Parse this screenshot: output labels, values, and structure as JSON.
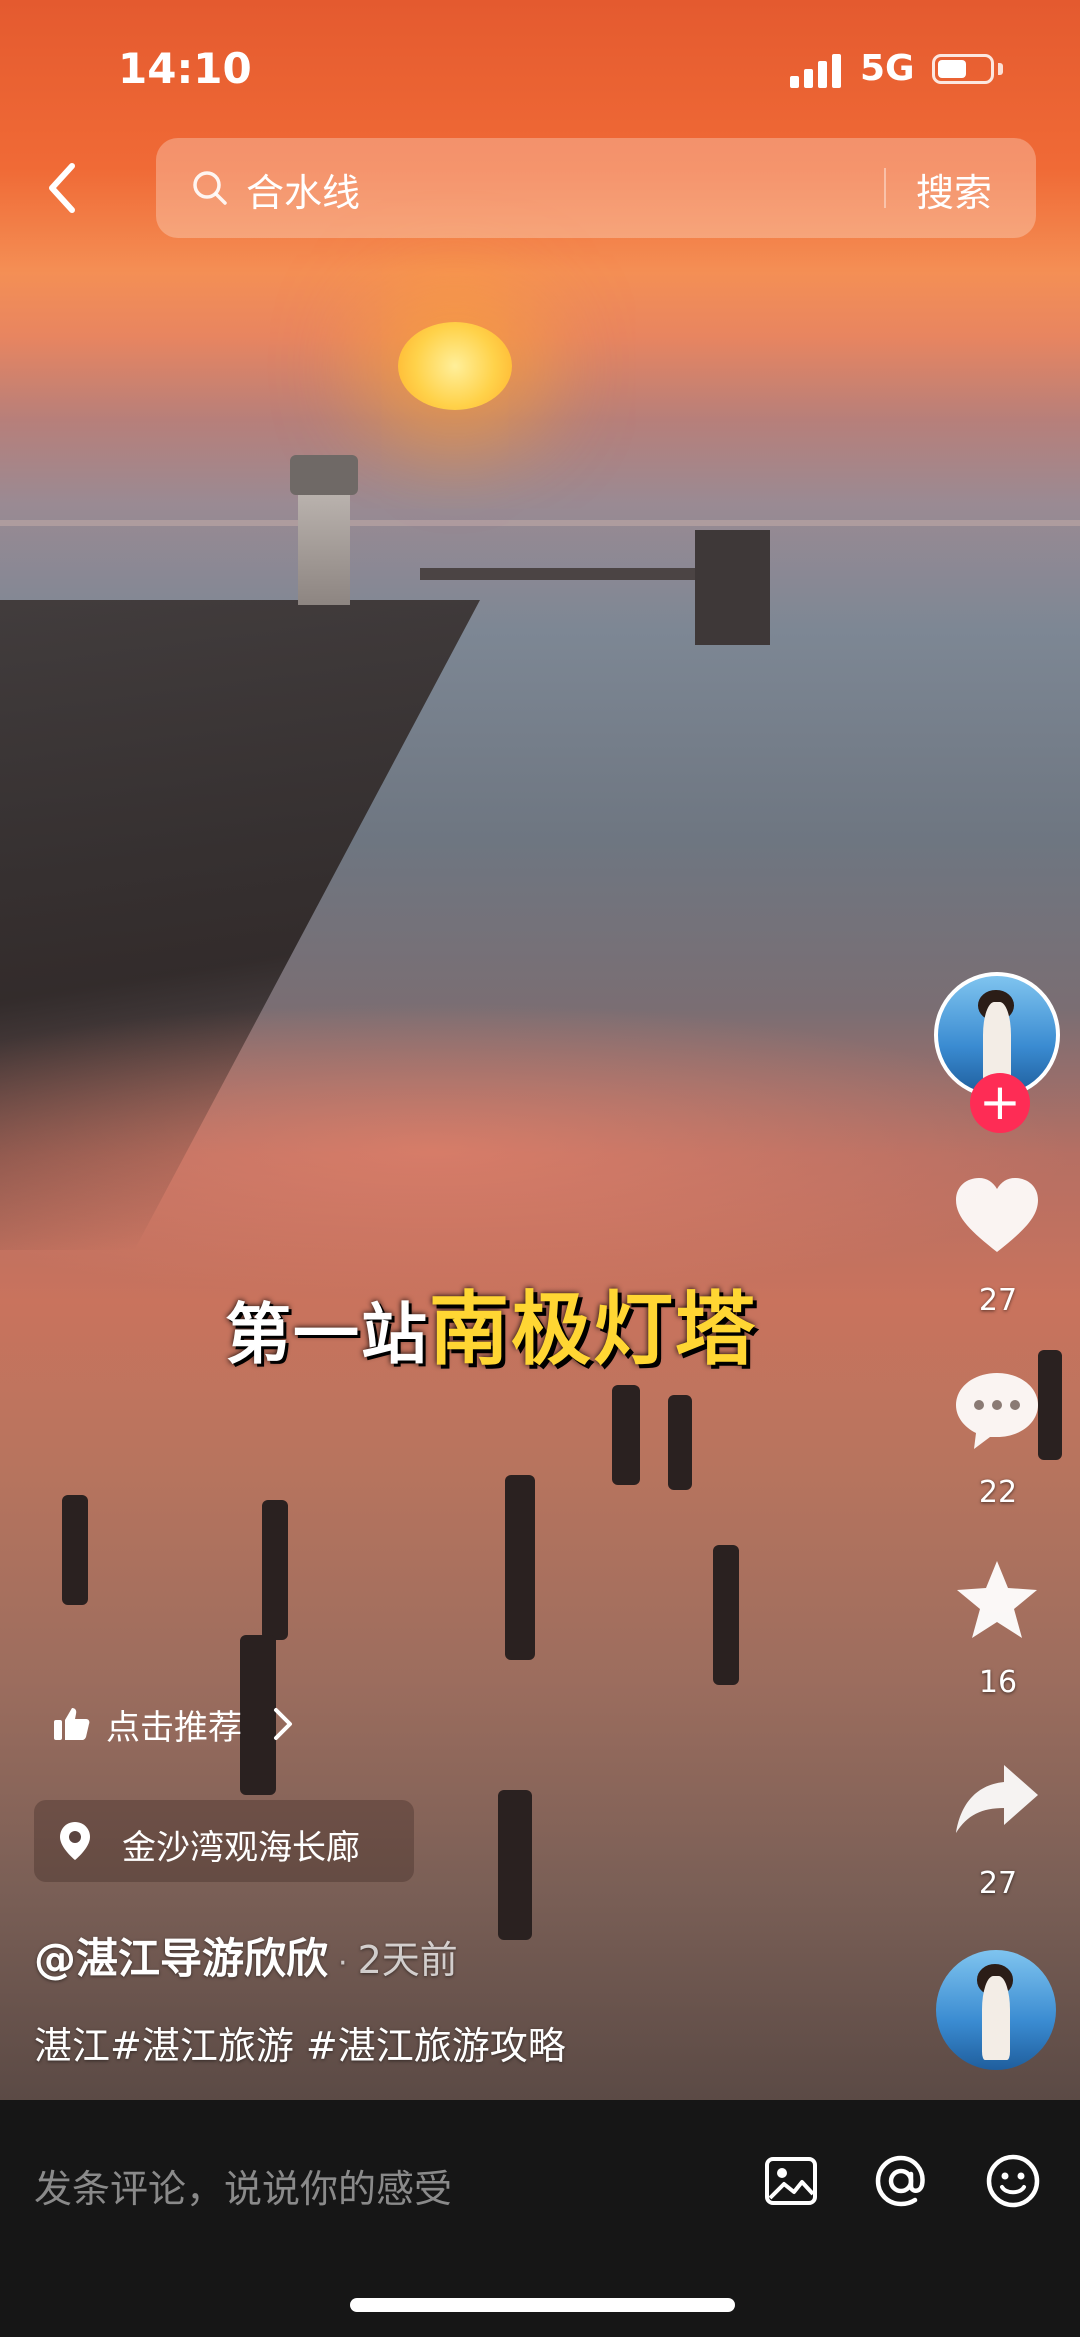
{
  "status_bar": {
    "time": "14:10",
    "network": "5G",
    "battery_level": 0.55
  },
  "search": {
    "query": "合水线",
    "button_label": "搜索"
  },
  "video": {
    "caption_white": "第一站",
    "caption_yellow": "南极灯塔"
  },
  "actions": {
    "likes": "27",
    "comments": "22",
    "favorites": "16",
    "shares": "27"
  },
  "recommend": {
    "label": "点击推荐"
  },
  "location": {
    "name": "金沙湾观海长廊"
  },
  "post": {
    "author": "@湛江导游欣欣",
    "separator": "·",
    "time_ago": "2天前",
    "description": "湛江#湛江旅游 #湛江旅游攻略"
  },
  "comment_bar": {
    "placeholder": "发条评论，说说你的感受"
  },
  "icons": [
    "back-icon",
    "search-icon",
    "heart-icon",
    "comment-icon",
    "star-icon",
    "share-icon",
    "thumbs-up-icon",
    "chevron-right-icon",
    "location-pin-icon",
    "image-icon",
    "at-icon",
    "emoji-icon"
  ]
}
